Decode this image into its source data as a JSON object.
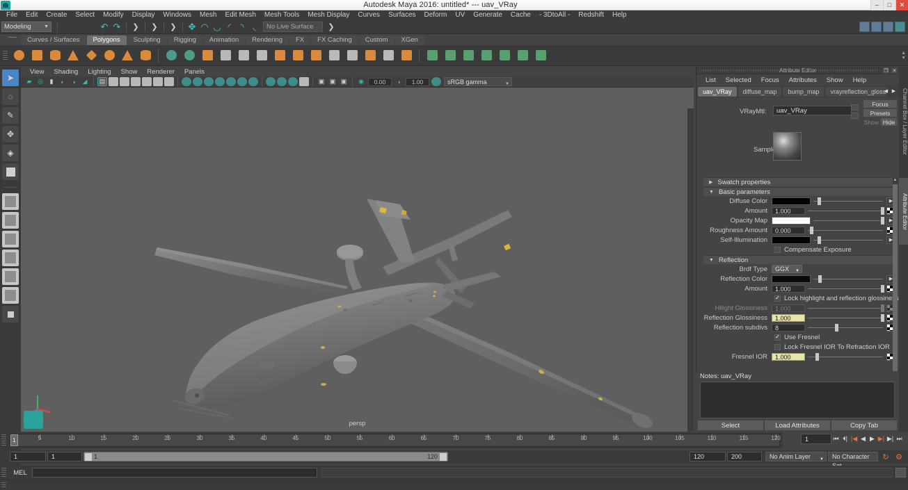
{
  "window": {
    "title": "Autodesk Maya 2016: untitled*  ---  uav_VRay",
    "minimize": "–",
    "maximize": "□",
    "close": "✕",
    "logo_icon": "maya-logo-icon"
  },
  "menubar": {
    "items": [
      "File",
      "Edit",
      "Create",
      "Select",
      "Modify",
      "Display",
      "Windows",
      "Mesh",
      "Edit Mesh",
      "Mesh Tools",
      "Mesh Display",
      "Curves",
      "Surfaces",
      "Deform",
      "UV",
      "Generate",
      "Cache",
      "- 3DtoAll -",
      "Redshift",
      "Help"
    ]
  },
  "statusbar": {
    "mode": "Modeling",
    "live_surface": "No Live Surface",
    "icons": [
      "new-scene-icon",
      "open-scene-icon",
      "save-scene-icon",
      "undo-icon",
      "redo-icon",
      "select-by-hierarchy-icon",
      "select-by-object-icon",
      "select-by-component-icon",
      "snap-to-grid-icon",
      "snap-to-curve-icon",
      "snap-to-point-icon",
      "snap-to-projected-center-icon",
      "snap-to-view-plane-icon",
      "make-live-icon"
    ],
    "right_icons": [
      "show-hide-attribute-editor-icon",
      "show-hide-tool-settings-icon",
      "show-hide-channel-box-icon",
      "render-view-icon"
    ]
  },
  "shelf": {
    "tabs": [
      "Curves / Surfaces",
      "Polygons",
      "Sculpting",
      "Rigging",
      "Animation",
      "Rendering",
      "FX",
      "FX Caching",
      "Custom",
      "XGen"
    ],
    "active_tab": "Polygons",
    "icons": [
      "poly-sphere-icon",
      "poly-cube-icon",
      "poly-cylinder-icon",
      "poly-cone-icon",
      "poly-torus-icon",
      "poly-plane-icon",
      "poly-pyramid-icon",
      "poly-prism-icon",
      "poly-combine-icon",
      "poly-separate-icon",
      "poly-mirror-icon",
      "poly-smooth-icon",
      "poly-extrude-icon",
      "poly-bevel-icon",
      "poly-bridge-icon",
      "poly-append-icon",
      "poly-wedge-icon",
      "poly-boolean-icon",
      "poly-crease-icon",
      "poly-reduce-icon",
      "poly-triangulate-icon",
      "poly-quadrangulate-icon",
      "uv-planar-icon",
      "uv-cylindrical-icon",
      "uv-spherical-icon",
      "uv-automatic-icon",
      "uv-unfold-icon",
      "uv-editor-icon",
      "uv-layout-icon"
    ]
  },
  "toolbox": {
    "items": [
      {
        "name": "select-tool",
        "icon": "arrow-cursor-icon",
        "active": true
      },
      {
        "name": "lasso-select-tool",
        "icon": "lasso-icon",
        "active": false
      },
      {
        "name": "paint-select-tool",
        "icon": "paint-brush-icon",
        "active": false
      },
      {
        "name": "move-tool",
        "icon": "move-arrows-icon",
        "active": false
      },
      {
        "name": "rotate-tool",
        "icon": "rotate-circle-icon",
        "active": false
      },
      {
        "name": "scale-tool",
        "icon": "scale-box-icon",
        "active": false
      },
      {
        "name": "last-tool",
        "icon": "last-tool-icon",
        "active": false
      }
    ],
    "layouts": [
      "single-pane-layout",
      "four-pane-layout",
      "two-pane-stacked-layout",
      "persp-outliner-layout",
      "persp-graph-layout",
      "three-pane-layout",
      "hypershade-layout",
      "blank-layout"
    ]
  },
  "viewport": {
    "menus": [
      "View",
      "Shading",
      "Lighting",
      "Show",
      "Renderer",
      "Panels"
    ],
    "camera_label": "persp",
    "exposure": "0.00",
    "gamma_value": "1.00",
    "color_space": "sRGB gamma",
    "model": "uav-drone-model",
    "icons": [
      "camera-icon",
      "camera-attributes-icon",
      "bookmark-icon",
      "two-sided-lighting-icon",
      "shadows-icon",
      "screen-space-ao-icon",
      "wireframe-icon",
      "smooth-shade-all-icon",
      "shaded-wireframe-icon",
      "hardware-texturing-icon",
      "use-default-material-icon",
      "xray-icon",
      "xray-joints-icon",
      "lights-icon",
      "light-quality-icon",
      "shadow-icon",
      "motion-blur-icon",
      "multisample-icon",
      "ambient-occlusion-icon",
      "depth-of-field-icon",
      "grid-icon",
      "film-gate-icon",
      "resolution-gate-icon",
      "gate-mask-icon",
      "isolate-select-icon",
      "exposure-icon",
      "gamma-icon",
      "color-management-icon"
    ]
  },
  "attribute_editor": {
    "panel_title": "Attribute Editor",
    "menus": [
      "List",
      "Selected",
      "Focus",
      "Attributes",
      "Show",
      "Help"
    ],
    "tabs": [
      "uav_VRay",
      "diffuse_map",
      "bump_map",
      "vrayreflection_glossiness_"
    ],
    "active_tab": "uav_VRay",
    "node_type_label": "VRayMtl:",
    "node_name": "uav_VRay",
    "side_buttons": {
      "focus": "Focus",
      "presets": "Presets",
      "show": "Show",
      "hide": "Hide"
    },
    "sample_label": "Sample",
    "sections": [
      {
        "name": "Swatch properties",
        "expanded": false
      },
      {
        "name": "Basic parameters",
        "expanded": true
      },
      {
        "name": "Reflection",
        "expanded": true
      }
    ],
    "basic_parameters": [
      {
        "label": "Diffuse Color",
        "type": "color",
        "color": "#000000",
        "slider": 0.06
      },
      {
        "label": "Amount",
        "type": "number",
        "value": "1.000",
        "slider": 0.97
      },
      {
        "label": "Opacity Map",
        "type": "color",
        "color": "#ffffff",
        "slider": 0.97
      },
      {
        "label": "Roughness Amount",
        "type": "number",
        "value": "0.000",
        "slider": 0.03
      },
      {
        "label": "Self-Illumination",
        "type": "color",
        "color": "#000000",
        "slider": 0.06
      }
    ],
    "compensate_exposure": {
      "label": "Compensate Exposure",
      "checked": false
    },
    "reflection": {
      "brdf_label": "Brdf Type",
      "brdf_value": "GGX",
      "rows": [
        {
          "label": "Reflection Color",
          "type": "color",
          "color": "#0a0a0a",
          "slider": 0.07
        },
        {
          "label": "Amount",
          "type": "number",
          "value": "1.000",
          "slider": 0.97
        },
        {
          "label": "Hilight Glossiness",
          "type": "number",
          "value": "1.000",
          "slider": 0.97,
          "disabled": true
        },
        {
          "label": "Reflection Glossiness",
          "type": "number",
          "value": "1.000",
          "slider": 0.97,
          "highlight": true
        },
        {
          "label": "Reflection subdivs",
          "type": "number",
          "value": "8",
          "slider": 0.36
        },
        {
          "label": "Fresnel IOR",
          "type": "number",
          "value": "1.000",
          "slider": 0.1,
          "highlight": true
        }
      ],
      "lock_glossiness": {
        "label": "Lock highlight and reflection glossiness",
        "checked": true
      },
      "use_fresnel": {
        "label": "Use Fresnel",
        "checked": true
      },
      "lock_fresnel_ior": {
        "label": "Lock Fresnel IOR To Refraction IOR",
        "checked": false
      }
    },
    "notes_label": "Notes:",
    "notes_target": "uav_VRay",
    "notes_text": "",
    "bottom_buttons": [
      "Select",
      "Load Attributes",
      "Copy Tab"
    ],
    "vertical_tabs": [
      "Channel Box / Layer Editor",
      "Attribute Editor"
    ]
  },
  "timeline": {
    "start": 1,
    "end": 120,
    "current_frame": "1",
    "ticks": [
      5,
      10,
      15,
      20,
      25,
      30,
      35,
      40,
      45,
      50,
      55,
      60,
      65,
      70,
      75,
      80,
      85,
      90,
      95,
      100,
      105,
      110,
      115,
      120
    ],
    "frame_field": "1",
    "playback_icons": [
      "go-to-start-icon",
      "step-back-keyframe-icon",
      "step-back-frame-icon",
      "play-backwards-icon",
      "play-forwards-icon",
      "step-forward-frame-icon",
      "step-forward-keyframe-icon",
      "go-to-end-icon"
    ]
  },
  "range": {
    "anim_start": "1",
    "range_start": "1",
    "slider_min": "1",
    "slider_max": "120",
    "range_end": "120",
    "anim_end": "200",
    "anim_layer": "No Anim Layer",
    "character_set": "No Character Set",
    "icons": [
      "auto-keyframe-icon",
      "animation-preferences-icon"
    ]
  },
  "command_line": {
    "language": "MEL",
    "input": "",
    "output": "",
    "script-editor-icon": "script-editor-icon"
  }
}
